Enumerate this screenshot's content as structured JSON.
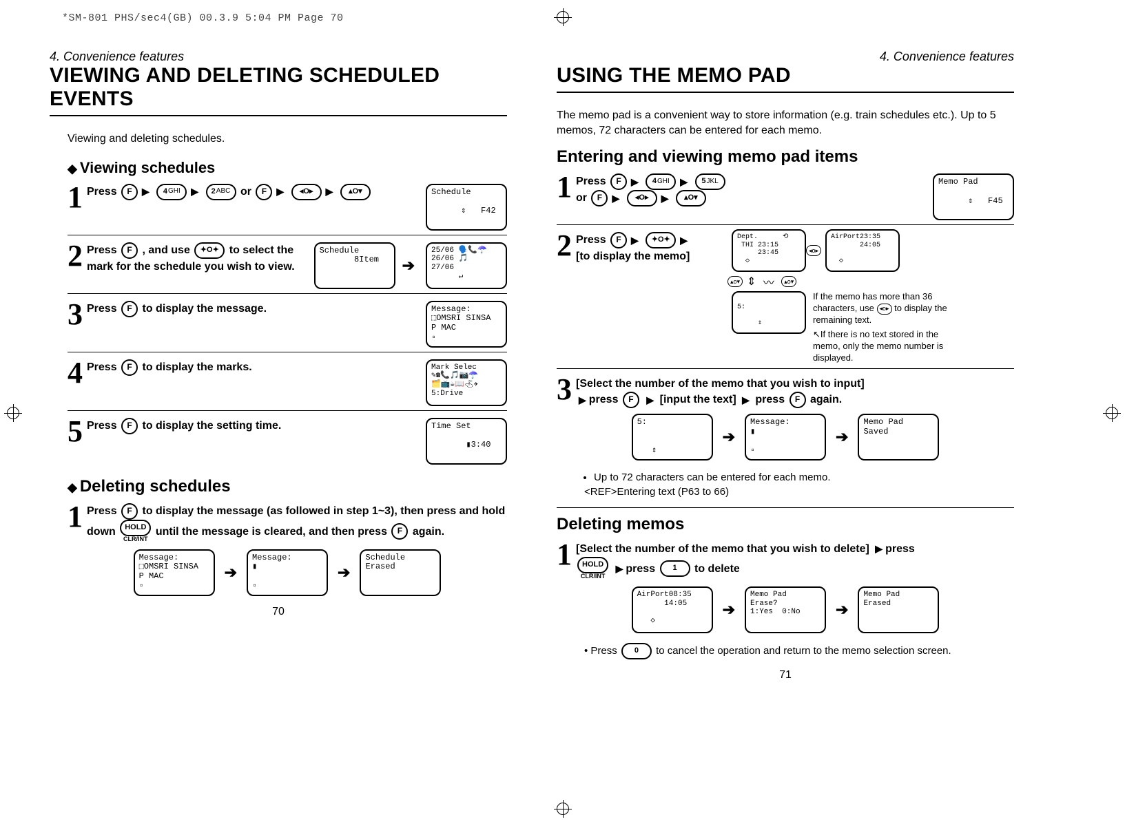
{
  "header_print": "*SM-801 PHS/sec4(GB)  00.3.9 5:04 PM  Page 70",
  "left": {
    "breadcrumb": "4. Convenience features",
    "title": "VIEWING AND DELETING SCHEDULED EVENTS",
    "intro": "Viewing and deleting schedules.",
    "viewing_head": "Viewing schedules",
    "step1_pre": "Press ",
    "step1_or": " or ",
    "step1_lcd": "Schedule\n\n      ⇕   F42",
    "step2a": "Press ",
    "step2b": " , and use ",
    "step2c": " to select the mark for the schedule you wish to view.",
    "step2_lcd1": "Schedule\n       8Item",
    "step2_lcd2": "25/06 🗣️📞☂️\n26/06 🎵\n27/06\n      ↵",
    "step3": " to display the message.",
    "step3_pre": "Press ",
    "step3_lcd": "Message:\n⬚OMSRI SINSA\nP MAC\n▫",
    "step4_pre": "Press ",
    "step4": " to display the marks.",
    "step4_lcd": "Mark Selec\n✎☎📞🎵📷☂️\n🗂️📺☕︎📖⛳︎✈\n5:Drive",
    "step5_pre": "Press ",
    "step5": " to display the setting time.",
    "step5_lcd": "Time Set\n\n       ▮3:40",
    "deleting_head": "Deleting schedules",
    "del1a": "Press ",
    "del1b": " to display the message (as followed in step 1~3), then press and hold down ",
    "del1c": " until the message is cleared, and then press ",
    "del1d": " again.",
    "del_lcd1": "Message:\n⬚OMSRI SINSA\nP MAC\n▫",
    "del_lcd2": "Message:\n▮\n\n▫",
    "del_lcd3": "Schedule\nErased",
    "page_num": "70"
  },
  "right": {
    "breadcrumb": "4. Convenience features",
    "title": "USING THE MEMO PAD",
    "intro": "The memo pad is a convenient way to store information (e.g. train schedules etc.). Up to 5 memos, 72 characters can be entered for each memo.",
    "enter_head": "Entering and viewing memo pad items",
    "step1_pre": "Press ",
    "step1_or": "or ",
    "step1_lcd": "Memo Pad\n\n      ⇕   F45",
    "step2_pre": "Press ",
    "step2_post": "[to display the memo]",
    "step2_lcd1": "Dept.      ⟲\n THI 23:15\n     23:45\n  ◇",
    "step2_lcd2": "AirPort23:35\n       24:05\n\n  ◇",
    "step2_lcd3": "\n5:\n\n     ⇕",
    "aside1": "If the memo has more than 36 characters, use",
    "aside1b": " to display the remaining  text.",
    "aside2": "If there is no text stored in the memo, only the memo number is displayed.",
    "step3a": "[Select the number of the memo that you wish to input]",
    "step3b": "press ",
    "step3c": " [input the text] ",
    "step3d": "press ",
    "step3e": " again.",
    "step3_lcd1": "5:\n\n\n   ⇕",
    "step3_lcd2": "Message:\n▮\n\n▫",
    "step3_lcd3": "Memo Pad\nSaved",
    "note1": "Up to 72 characters can be entered for each memo.",
    "note2": "<REF>Entering text (P63 to 66)",
    "del_head": "Deleting memos",
    "del1a": "[Select the number of the memo that you wish to delete] ",
    "del1b": "press ",
    "del1c": "press ",
    "del1d": " to delete",
    "del_lcd1": "AirPort08:35\n      14:05\n\n   ◇",
    "del_lcd2": "Memo Pad\nErase?\n1:Yes  0:No",
    "del_lcd3": "Memo Pad\nErased",
    "cancel_pre": "Press ",
    "cancel_post": " to cancel the operation and return to the memo selection screen.",
    "page_num": "71"
  },
  "keys": {
    "F": "F",
    "4ghi": "4",
    "4sub": "GHI",
    "2abc": "2",
    "2sub": "ABC",
    "5jkl": "5",
    "5sub": "JKL",
    "Ozl": "O",
    "Ozr": "O",
    "HOLD": "HOLD",
    "clrint": "CLR/INT",
    "one": "1",
    "zero": "0"
  }
}
